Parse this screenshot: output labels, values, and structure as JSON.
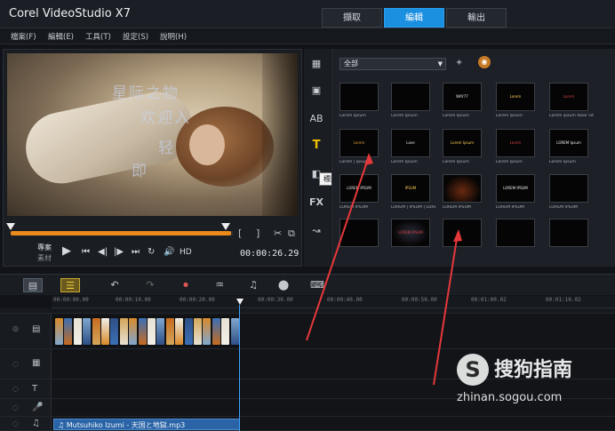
{
  "app": {
    "title": "Corel VideoStudio X7"
  },
  "steps": [
    {
      "label": "擷取",
      "active": false
    },
    {
      "label": "編輯",
      "active": true
    },
    {
      "label": "輸出",
      "active": false
    }
  ],
  "menu": [
    "檔案(F)",
    "編輯(E)",
    "工具(T)",
    "設定(S)",
    "說明(H)"
  ],
  "player": {
    "overlay_text": [
      "星际之物",
      "欢迎入",
      "轻",
      "即"
    ],
    "mode_project": "專案",
    "mode_clip": "素材",
    "timecode": "00:00:26.29",
    "volume_label": "HD"
  },
  "library": {
    "category": "全部",
    "tooltip": "標題",
    "icons": [
      "media-icon",
      "instant-project-icon",
      "transition-icon",
      "title-icon",
      "graphic-icon",
      "filter-icon",
      "path-icon"
    ],
    "captions": [
      [
        "Lorem Ipsum",
        "Lorem Ipsum",
        "Lorem Ipsum",
        "Lorem Ipsum",
        "Lorem ipsum dolor sit",
        "Lorem"
      ],
      [
        "Lorem | Ipsum",
        "Lorem Ipsum",
        "Lorem Ipsum",
        "Lorem Ipsum",
        "Lorem Ipsum",
        "Lorem"
      ],
      [
        "LOREM IPSUM",
        "LOREM | IPSUM | LORE",
        "LOREM IPSUM",
        "LOREM IPSUM",
        "LOREM IPSUM",
        "LOREM"
      ],
      [
        "",
        "",
        "",
        "",
        "",
        ""
      ]
    ],
    "thumb_text": [
      [
        "",
        "",
        "WAY77",
        "Lorem",
        "Lorem",
        ""
      ],
      [
        "Lorem",
        "Love",
        "Lorem Ipsum",
        "Lorem",
        "LOREM Ipsum",
        ""
      ],
      [
        "LOREM IPSUM",
        "IPSUM",
        "",
        "LOREM IPSUM",
        "",
        ""
      ],
      [
        "",
        "LOREM IPSUM",
        "",
        "",
        "",
        ""
      ]
    ]
  },
  "timeline": {
    "ruler": [
      "00:00:00.00",
      "00:00:10.00",
      "00:00:20.00",
      "00:00:30.00",
      "00:00:40.00",
      "00:00:50.00",
      "00:01:00.02",
      "00:01:10.02"
    ],
    "audio_clip": "Mutsuhiko Izumi - 天国と地獄.mp3"
  },
  "watermark": {
    "logo": "S",
    "name": "搜狗指南",
    "url": "zhinan.sogou.com"
  },
  "colors": {
    "accent": "#1b8fe0",
    "scrub": "#e98a1a",
    "annotation": "#e5383b"
  }
}
